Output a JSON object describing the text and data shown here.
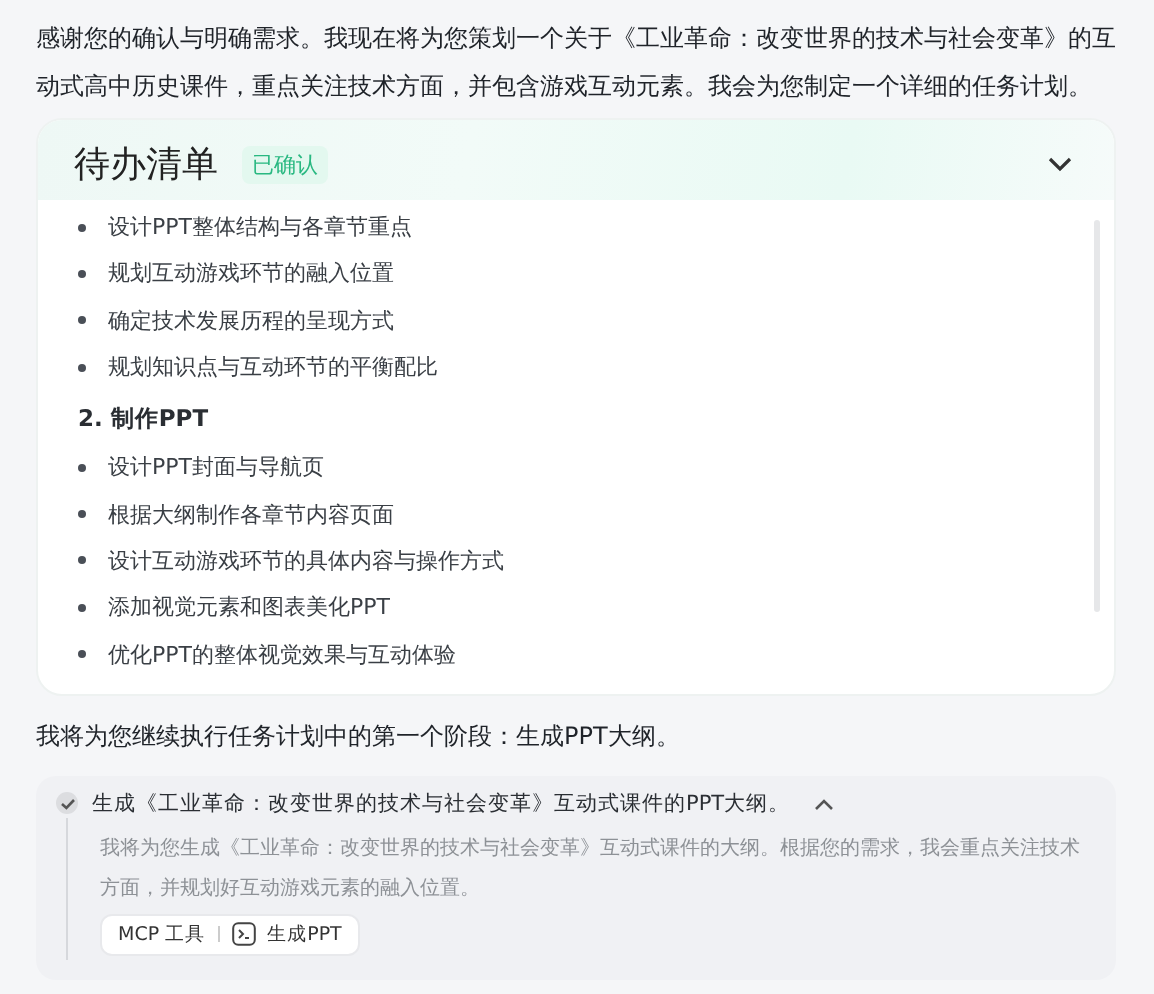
{
  "intro": "感谢您的确认与明确需求。我现在将为您策划一个关于《工业革命：改变世界的技术与社会变革》的互动式高中历史课件，重点关注技术方面，并包含游戏互动元素。我会为您制定一个详细的任务计划。",
  "todo": {
    "title": "待办清单",
    "badge": "已确认",
    "expanded": true,
    "items": [
      {
        "kind": "bullet",
        "text": "设计PPT整体结构与各章节重点"
      },
      {
        "kind": "bullet",
        "text": "规划互动游戏环节的融入位置"
      },
      {
        "kind": "bullet",
        "text": "确定技术发展历程的呈现方式"
      },
      {
        "kind": "bullet",
        "text": "规划知识点与互动环节的平衡配比"
      },
      {
        "kind": "heading",
        "text": "2. 制作PPT"
      },
      {
        "kind": "bullet",
        "text": "设计PPT封面与导航页"
      },
      {
        "kind": "bullet",
        "text": "根据大纲制作各章节内容页面"
      },
      {
        "kind": "bullet",
        "text": "设计互动游戏环节的具体内容与操作方式"
      },
      {
        "kind": "bullet",
        "text": "添加视觉元素和图表美化PPT"
      },
      {
        "kind": "bullet",
        "text": "优化PPT的整体视觉效果与互动体验"
      }
    ]
  },
  "next": "我将为您继续执行任务计划中的第一个阶段：生成PPT大纲。",
  "step": {
    "title": "生成《工业革命：改变世界的技术与社会变革》互动式课件的PPT大纲。",
    "done": true,
    "expanded": true,
    "description": "我将为您生成《工业革命：改变世界的技术与社会变革》互动式课件的大纲。根据您的需求，我会重点关注技术方面，并规划好互动游戏元素的融入位置。",
    "tool": {
      "label": "MCP 工具",
      "name": "生成PPT"
    }
  }
}
